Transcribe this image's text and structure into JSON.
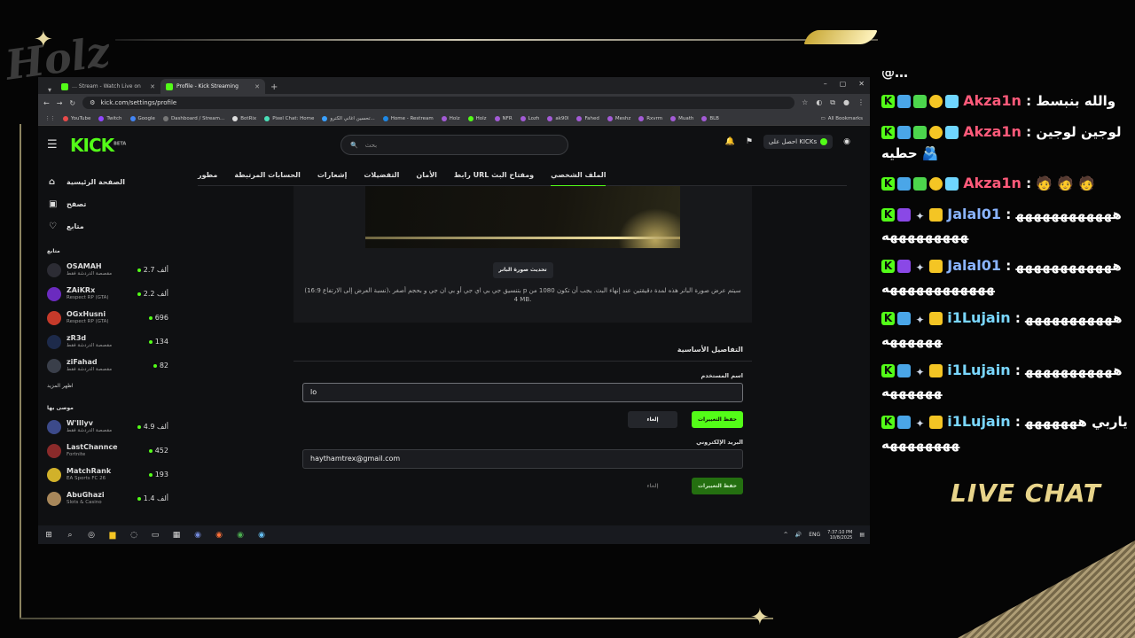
{
  "browser": {
    "tabs": [
      {
        "title": "… Stream - Watch Live on",
        "active": false
      },
      {
        "title": "Profile - Kick Streaming",
        "active": true
      }
    ],
    "url": "kick.com/settings/profile",
    "bookmarks": [
      "YouTube",
      "Twitch",
      "Google",
      "Dashboard / Stream...",
      "BotRix",
      "Pixel Chat: Home",
      "تحسين اغاني الكترو...",
      "Home - Restream",
      "Holz",
      "Holz",
      "NFR",
      "Lozh",
      "ak90l",
      "Fahed",
      "Meshz",
      "Rxvrm",
      "Muath",
      "BLB"
    ],
    "all_bookmarks": "All Bookmarks"
  },
  "kick": {
    "logo": "KICK",
    "logo_beta": "BETA",
    "search_placeholder": "بحث",
    "get_kicks": "احصل على KICKs",
    "nav": [
      {
        "label": "الصفحة الرئيسية",
        "icon": "home-icon"
      },
      {
        "label": "تصفح",
        "icon": "browse-icon"
      },
      {
        "label": "متابع",
        "icon": "heart-icon"
      }
    ],
    "following_title": "متابع",
    "following": [
      {
        "name": "OSAMAH",
        "category": "مقصصة الدردشة فقط",
        "viewers": "2.7 ألف",
        "avatar": "#2c2c34"
      },
      {
        "name": "ZAiKRx",
        "category": "Respect RP (GTA)",
        "viewers": "2.2 ألف",
        "avatar": "#6b2bbf"
      },
      {
        "name": "OGxHusni",
        "category": "Respect RP (GTA)",
        "viewers": "696",
        "avatar": "#c53a2a"
      },
      {
        "name": "zR3d",
        "category": "مقصصة الدردشة فقط",
        "viewers": "134",
        "avatar": "#1d2a4a"
      },
      {
        "name": "ziFahad",
        "category": "مقصصة الدردشة فقط",
        "viewers": "82",
        "avatar": "#3a3f4a"
      }
    ],
    "show_more": "اظهر المزيد",
    "recommended_title": "موصى بها",
    "recommended": [
      {
        "name": "W'lllyv",
        "category": "مقصصة الدردشة فقط",
        "viewers": "4.9 ألف",
        "avatar": "#3c4a8a"
      },
      {
        "name": "LastChannce",
        "category": "Fortnite",
        "viewers": "452",
        "avatar": "#8a2a2a"
      },
      {
        "name": "MatchRank",
        "category": "EA Sports FC 26",
        "viewers": "193",
        "avatar": "#d1b12a"
      },
      {
        "name": "AbuGhazi",
        "category": "Slots & Casino",
        "viewers": "1.4 ألف",
        "avatar": "#a8875a"
      }
    ],
    "settings_tabs": [
      "الملف الشخصي",
      "رابط URL ومفتاح البث",
      "الأمان",
      "التفضيلات",
      "إشعارات",
      "الحسابات المرتبطة",
      "مطور"
    ],
    "banner_button": "تحديث صورة البانر",
    "banner_note": "بتنسيق جي بي اي جي أو بي ان جي و بحجم أصغر ،(نسبة العرض إلى الارتفاع 16:9) p سيتم عرض صورة البانر هذه لمدة دقيقتين عند إنهاء البث. يجب أن تكون 1080 من 4 MB.",
    "basic_details": "التفاصيل الأساسية",
    "username_label": "اسم المستخدم",
    "username_value": "lo",
    "email_label": "البريد الإلكتروني",
    "email_value": "haythamtrex@gmail.com",
    "save_label": "حفظ التغييرات",
    "cancel_label": "إلغاء"
  },
  "taskbar": {
    "lang": "ENG",
    "time": "7:37:10 PM",
    "date": "10/8/2025"
  },
  "chat": {
    "cut_top": "@…",
    "messages": [
      {
        "user": "Akza1n",
        "color": "#ff5a7a",
        "badges": [
          "b-k",
          "b-blue",
          "b-cube",
          "b-coin",
          "b-grid"
        ],
        "text": "والله بنبسط"
      },
      {
        "user": "Akza1n",
        "color": "#ff5a7a",
        "badges": [
          "b-k",
          "b-blue",
          "b-cube",
          "b-coin",
          "b-grid"
        ],
        "text": "لوجين لوجين حطيه 🫂"
      },
      {
        "user": "Akza1n",
        "color": "#ff5a7a",
        "badges": [
          "b-k",
          "b-blue",
          "b-cube",
          "b-coin",
          "b-grid"
        ],
        "text": "🧑 🧑 🧑"
      },
      {
        "user": "Jalal01",
        "color": "#8ab4ff",
        "badges": [
          "b-k",
          "b-purple",
          "b-spark",
          "b-crown"
        ],
        "text": "هههههههههههههههههههههه"
      },
      {
        "user": "Jalal01",
        "color": "#8ab4ff",
        "badges": [
          "b-k",
          "b-purple",
          "b-spark",
          "b-crown"
        ],
        "text": "ههههههههههههههههههههههههه"
      },
      {
        "user": "i1Lujain",
        "color": "#7ad7ff",
        "badges": [
          "b-k",
          "b-blue",
          "b-spark",
          "b-crown"
        ],
        "text": "هههههههههههههههههه"
      },
      {
        "user": "i1Lujain",
        "color": "#7ad7ff",
        "badges": [
          "b-k",
          "b-blue",
          "b-spark",
          "b-crown"
        ],
        "text": "هههههههههههههههههه"
      },
      {
        "user": "i1Lujain",
        "color": "#7ad7ff",
        "badges": [
          "b-k",
          "b-blue",
          "b-spark",
          "b-crown"
        ],
        "text": "ياربي هههههههههههههههه"
      }
    ],
    "title": "LIVE CHAT"
  }
}
